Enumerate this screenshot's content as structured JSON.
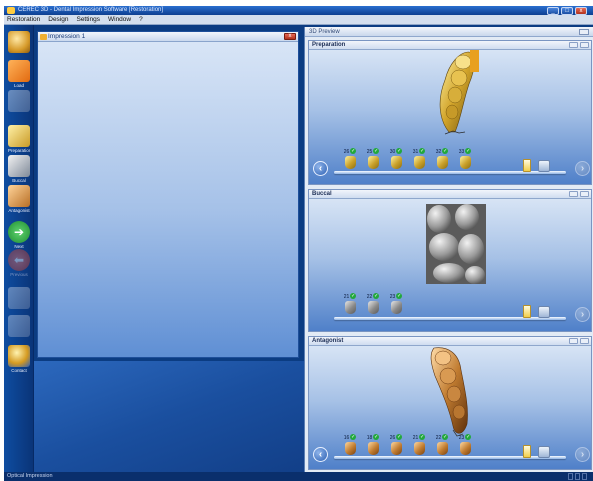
{
  "window": {
    "title": "CEREC 3D - Dental Impression Software [Restoration]",
    "controls": [
      "_",
      "□",
      "x"
    ]
  },
  "menu": [
    "Restoration",
    "Design",
    "Settings",
    "Window",
    "?"
  ],
  "toolbar": [
    {
      "icon": "globe-icon",
      "label": ""
    },
    {
      "icon": "open-folder-icon",
      "label": "Load"
    },
    {
      "icon": "save-icon",
      "label": ""
    },
    {
      "icon": "preparation-icon",
      "label": "Preparation"
    },
    {
      "icon": "buccal-icon",
      "label": "Buccal"
    },
    {
      "icon": "antagonist-icon",
      "label": "Antagonist"
    },
    {
      "icon": "next-arrow-icon",
      "label": "Next"
    },
    {
      "icon": "previous-arrow-icon",
      "label": "Previous"
    },
    {
      "icon": "tool-icon",
      "label": ""
    },
    {
      "icon": "layout-icon",
      "label": ""
    },
    {
      "icon": "contact-icon",
      "label": "Contact"
    }
  ],
  "impression_window": {
    "title": "Impression 1",
    "close": "x"
  },
  "preview": {
    "title": "3D Preview",
    "panels": [
      {
        "title": "Preparation",
        "tooth_style": "gold",
        "teeth": [
          "26",
          "25",
          "30",
          "31",
          "32",
          "33"
        ]
      },
      {
        "title": "Buccal",
        "tooth_style": "grey",
        "teeth": [
          "21",
          "22",
          "23"
        ]
      },
      {
        "title": "Antagonist",
        "tooth_style": "copper",
        "teeth": [
          "16",
          "18",
          "26",
          "21",
          "22",
          "23"
        ]
      }
    ]
  },
  "status": {
    "text": "Optical Impression"
  },
  "colors": {
    "app_bg": "#0b3c82",
    "check": "#22a83c",
    "gold_scan": "#c9a12a",
    "grey_scan": "#8a8a8a",
    "copper_scan": "#c07b30"
  }
}
